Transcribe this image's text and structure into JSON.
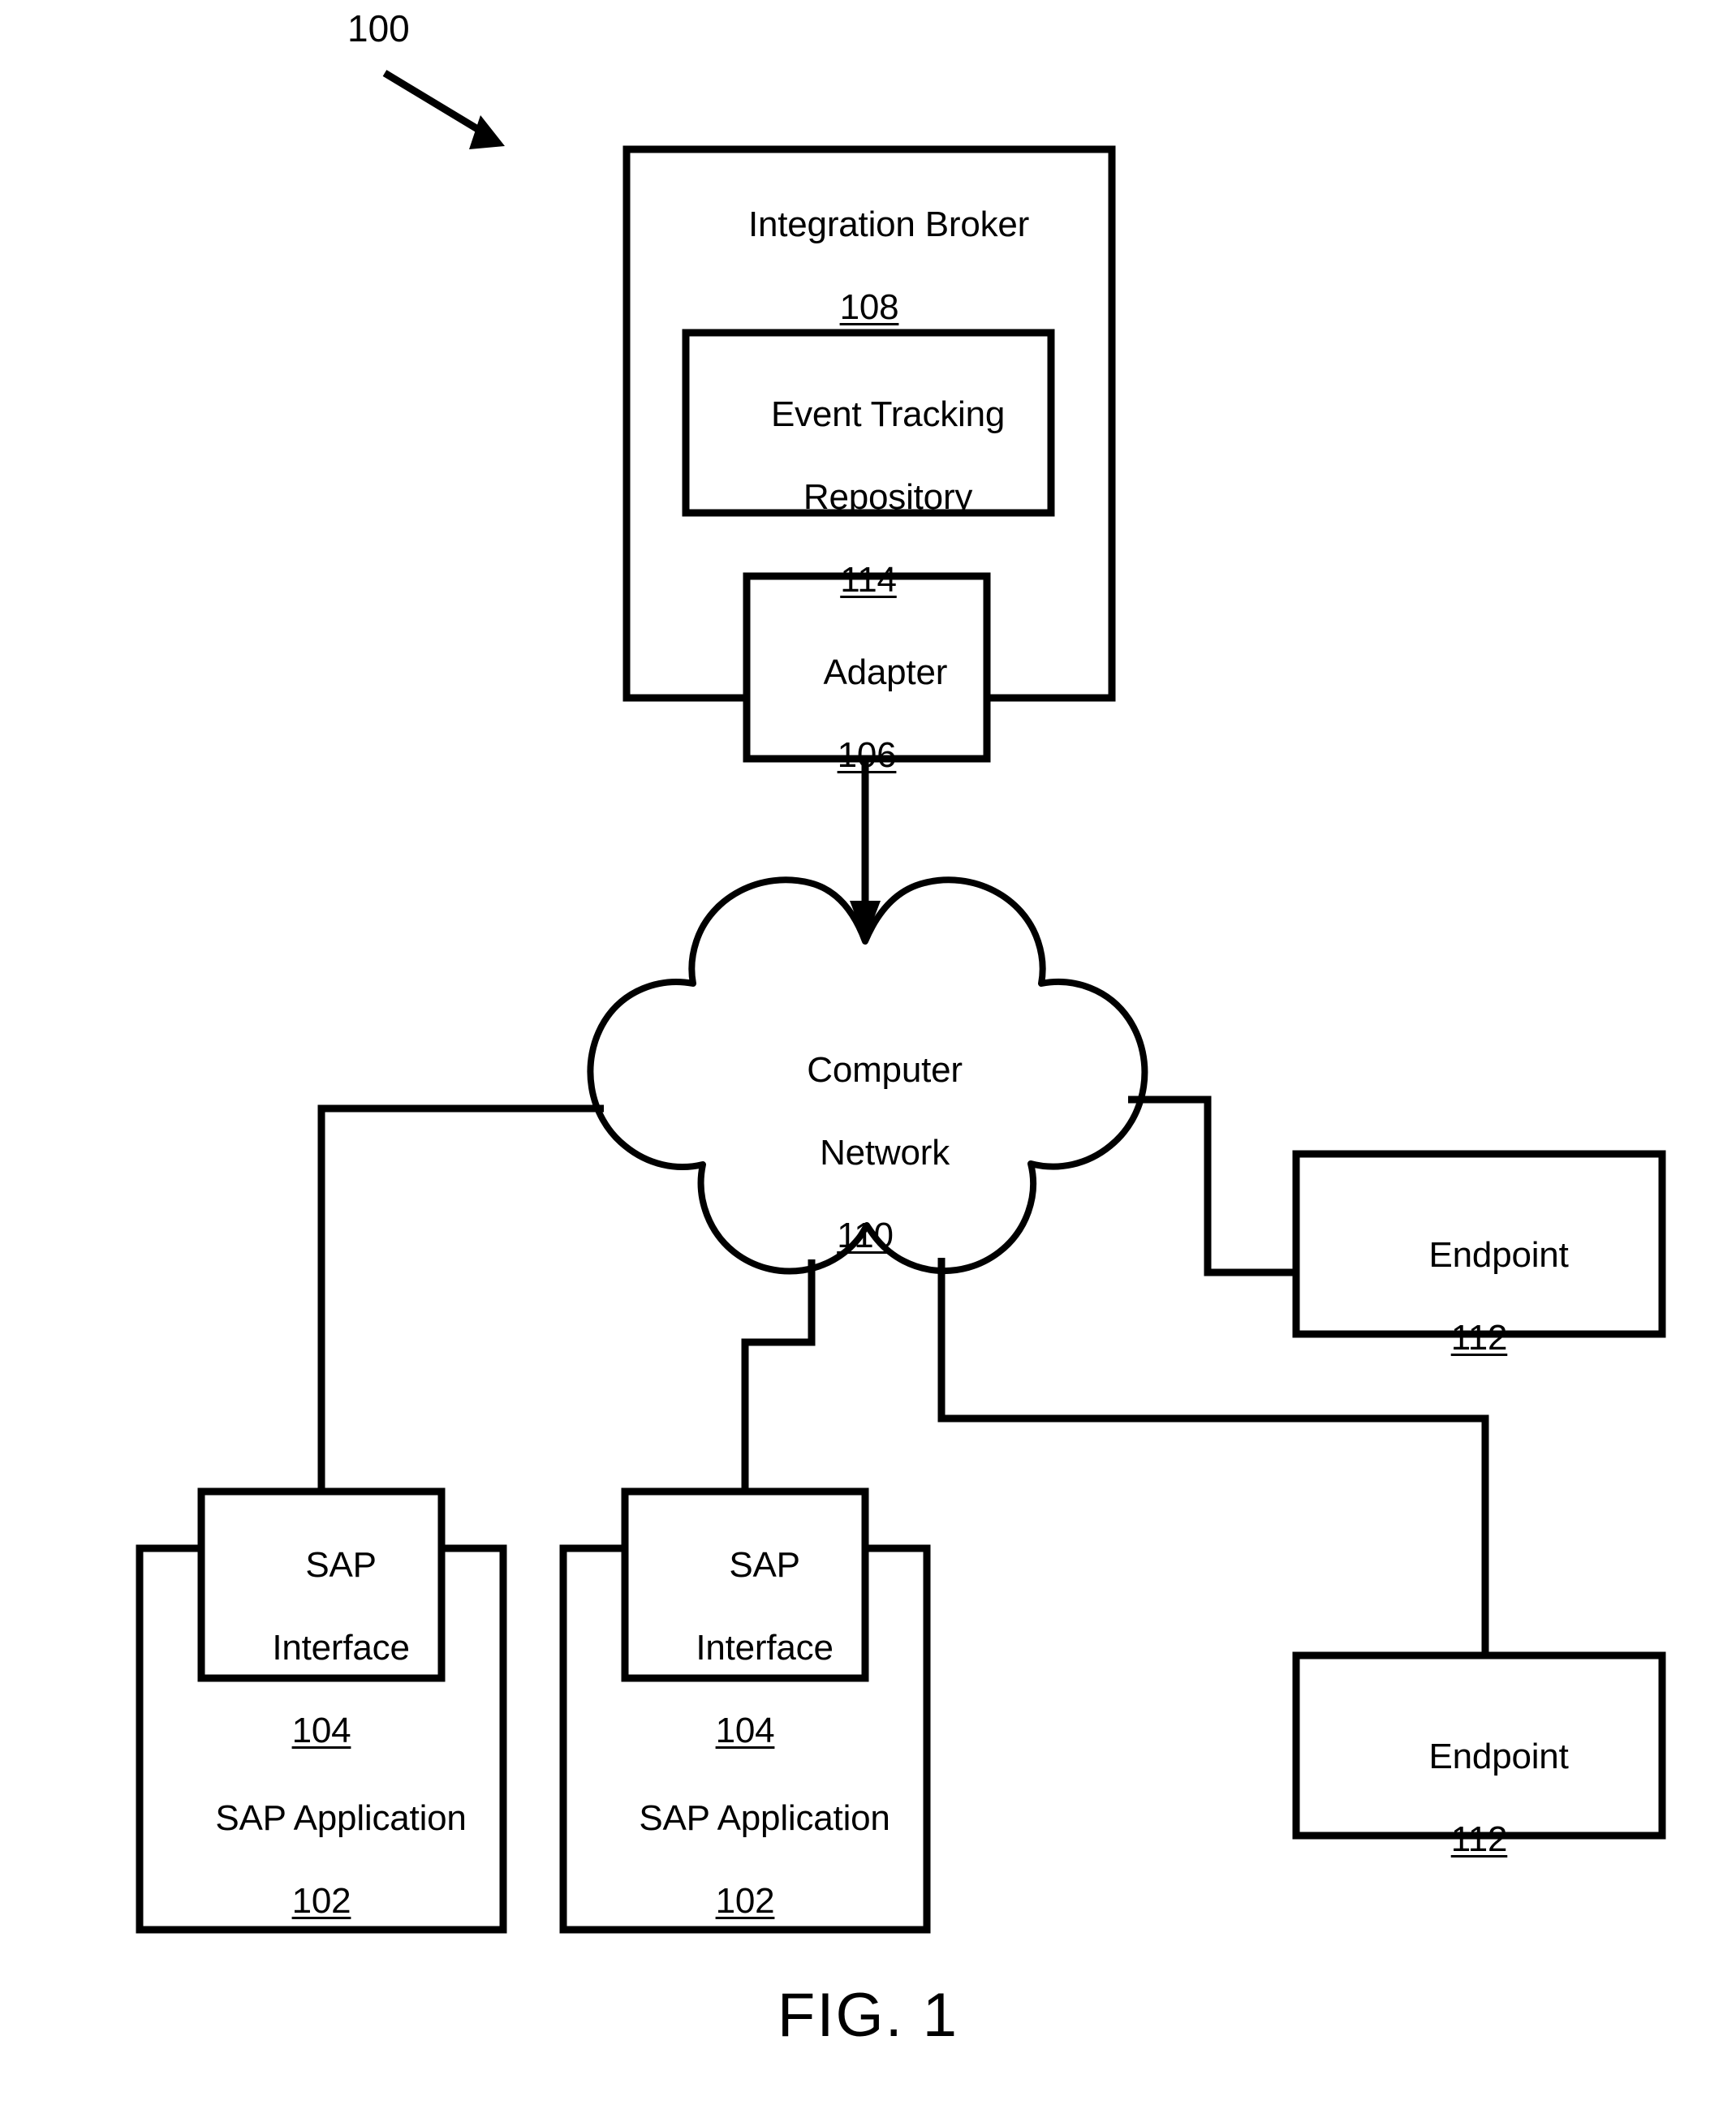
{
  "figure": {
    "caption": "FIG. 1",
    "system_callout": "100"
  },
  "nodes": {
    "integration_broker": {
      "label": "Integration Broker",
      "ref": "108"
    },
    "event_tracking_repository": {
      "label_line1": "Event Tracking",
      "label_line2": "Repository",
      "ref": "114"
    },
    "adapter": {
      "label": "Adapter",
      "ref": "106"
    },
    "computer_network": {
      "label_line1": "Computer",
      "label_line2": "Network",
      "ref": "110"
    },
    "endpoint_top": {
      "label": "Endpoint",
      "ref": "112"
    },
    "endpoint_bottom": {
      "label": "Endpoint",
      "ref": "112"
    },
    "sap_interface_left": {
      "label_line1": "SAP",
      "label_line2": "Interface",
      "ref": "104"
    },
    "sap_application_left": {
      "label": "SAP Application",
      "ref": "102"
    },
    "sap_interface_right": {
      "label_line1": "SAP",
      "label_line2": "Interface",
      "ref": "104"
    },
    "sap_application_right": {
      "label": "SAP Application",
      "ref": "102"
    }
  },
  "style": {
    "stroke_color": "#000000",
    "fill_color": "#ffffff"
  }
}
